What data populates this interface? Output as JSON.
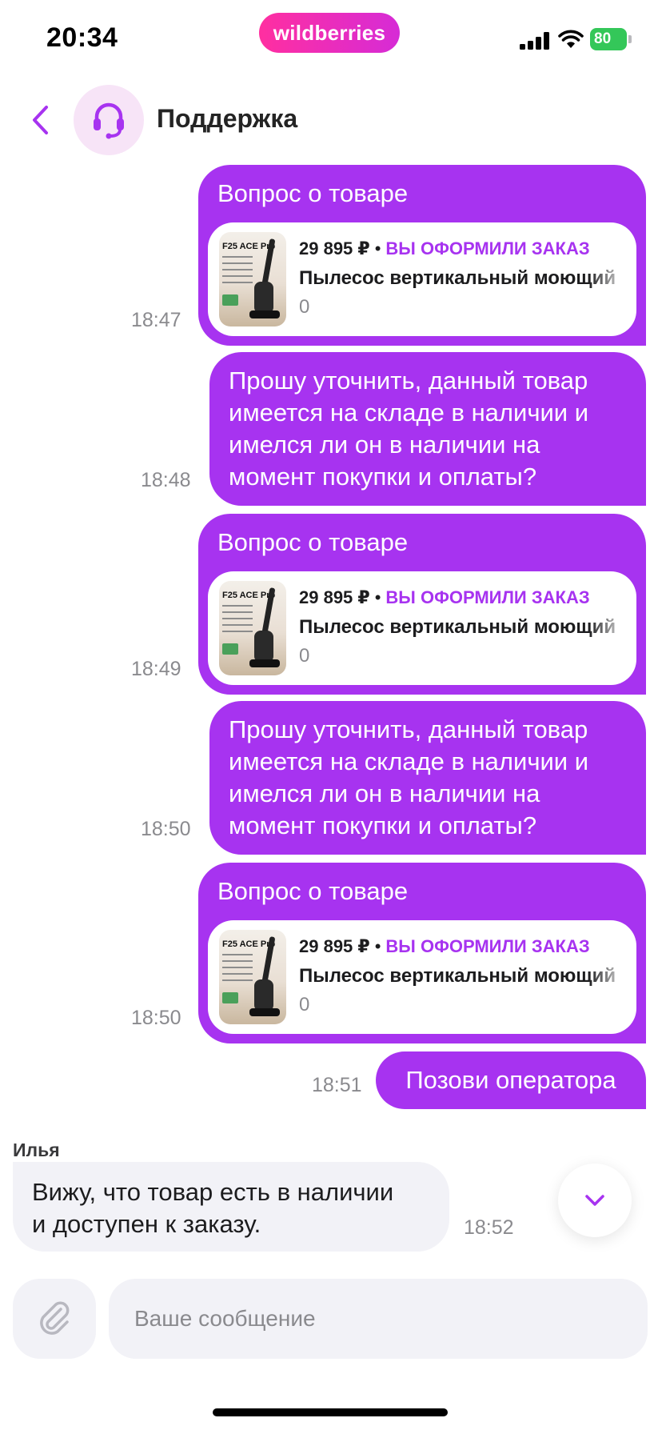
{
  "status_bar": {
    "time": "20:34",
    "battery": "80"
  },
  "brand": {
    "logo_text": "wildberries"
  },
  "header": {
    "title": "Поддержка"
  },
  "messages": [
    {
      "heading": "Вопрос о товаре",
      "time": "18:47",
      "product": {
        "thumb_title": "F25 ACE Pro",
        "price": "29 895 ₽",
        "dot": "•",
        "status": "ВЫ ОФОРМИЛИ ЗАКАЗ",
        "name": "Пылесос вертикальный моющий",
        "qty": "0"
      }
    },
    {
      "text_lines": [
        "Прошу уточнить, данный товар",
        "имеется на складе в наличии и",
        "имелся ли он в наличии на",
        "момент покупки и оплаты?"
      ],
      "time": "18:48"
    },
    {
      "heading": "Вопрос о товаре",
      "time": "18:49",
      "product": {
        "thumb_title": "F25 ACE Pro",
        "price": "29 895 ₽",
        "dot": "•",
        "status": "ВЫ ОФОРМИЛИ ЗАКАЗ",
        "name": "Пылесос вертикальный моющий",
        "qty": "0"
      }
    },
    {
      "text_lines": [
        "Прошу уточнить, данный товар",
        "имеется на складе в наличии и",
        "имелся ли он в наличии на",
        "момент покупки и оплаты?"
      ],
      "time": "18:50"
    },
    {
      "heading": "Вопрос о товаре",
      "time": "18:50",
      "product": {
        "thumb_title": "F25 ACE Pro",
        "price": "29 895 ₽",
        "dot": "•",
        "status": "ВЫ ОФОРМИЛИ ЗАКАЗ",
        "name": "Пылесос вертикальный моющий",
        "qty": "0"
      }
    },
    {
      "text": "Позови оператора",
      "time": "18:51"
    }
  ],
  "incoming": {
    "sender": "Илья",
    "text_lines": [
      "Вижу, что товар есть в наличии",
      "и доступен к заказу."
    ],
    "time": "18:52"
  },
  "composer": {
    "placeholder": "Ваше сообщение"
  },
  "colors": {
    "accent": "#a733f0",
    "brand_start": "#ff2fa0",
    "brand_end": "#d62bd6",
    "battery": "#34c759",
    "incoming_bg": "#f2f2f7"
  },
  "icons": {
    "back": "chevron-left-icon",
    "avatar": "headset-icon",
    "scroll": "chevron-down-icon",
    "attach": "paperclip-icon"
  }
}
